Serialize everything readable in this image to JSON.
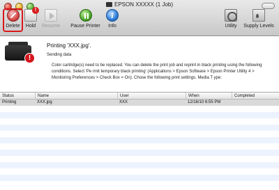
{
  "window": {
    "title": "EPSON XXXXX (1 Job)"
  },
  "toolbar": {
    "delete_label": "Delete",
    "hold_label": "Hold",
    "resume_label": "Resume",
    "pause_label": "Pause Printer",
    "info_label": "Info",
    "utility_label": "Utility",
    "supply_label": "Supply Levels"
  },
  "job": {
    "title": "Printing 'XXX.jpg'.",
    "status": "Sending data",
    "message": "Color cartridge(s) need to be replaced. You can delete the print job and reprint in black printing using the following conditions. Select 'Pe rmit temporary black printing' (Applications > Epson Software > Epson Printer Utility 4 > Monitoring Preferences > Check Box = On). Chose the following print settings. Media T ype:"
  },
  "table": {
    "columns": [
      "Status",
      "Name",
      "User",
      "When",
      "Completed"
    ],
    "rows": [
      {
        "status": "Printing",
        "name": "XXX.jpg",
        "user": "XXX",
        "when": "12/16/10 6:55 PM",
        "completed": ""
      }
    ]
  },
  "colors": {
    "delete_highlight": "#d8171b",
    "alert_badge": "#d4141b",
    "row_selected": "#d9d9d9",
    "row_stripe": "#edf3fe"
  },
  "icons": {
    "delete": "delete-icon",
    "hold": "hold-icon",
    "resume": "resume-icon",
    "pause": "pause-icon",
    "info": "info-icon",
    "utility": "utility-icon",
    "supply": "supply-levels-icon",
    "printer": "printer-icon",
    "alert": "alert-icon"
  }
}
